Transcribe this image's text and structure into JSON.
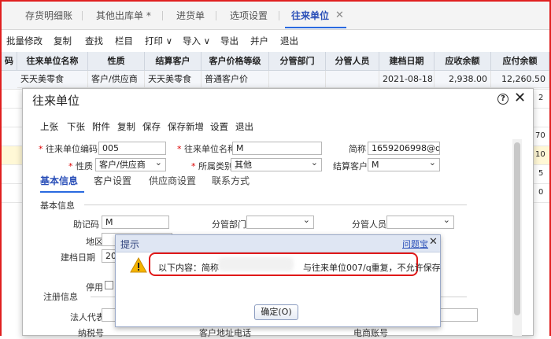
{
  "tabs": [
    {
      "label": "存货明细账"
    },
    {
      "label": "其他出库单 *"
    },
    {
      "label": "进货单"
    },
    {
      "label": "选项设置"
    },
    {
      "label": "往来单位"
    }
  ],
  "toolbar": [
    "批量修改",
    "复制",
    "查找",
    "栏目",
    "打印 ∨",
    "导入 ∨",
    "导出",
    "并户",
    "退出"
  ],
  "grid": {
    "headers": [
      "码",
      "往来单位名称",
      "性质",
      "结算客户",
      "客户价格等级",
      "分管部门",
      "分管人员",
      "建档日期",
      "应收余额",
      "应付余额"
    ],
    "row1": [
      "天天美零食",
      "客户/供应商",
      "天天美零食",
      "普通客户价",
      "",
      "",
      "2021-08-18",
      "2,938.00",
      "12,260.50"
    ],
    "edge_values": [
      "2",
      "70",
      "10",
      "5",
      "0"
    ]
  },
  "dialog": {
    "title": "往来单位",
    "help": "?",
    "close": "✕",
    "toolbar": [
      "上张",
      "下张",
      "附件",
      "复制",
      "保存",
      "保存新增",
      "设置",
      "退出"
    ],
    "fields": {
      "code_label": "往来单位编码",
      "code_value": "005",
      "name_label": "往来单位名称",
      "name_value": "M",
      "abbr_label": "简称",
      "abbr_value": "1659206998@q...",
      "nature_label": "性质",
      "nature_value": "客户/供应商",
      "category_label": "所属类别",
      "category_value": "其他",
      "settle_label": "结算客户",
      "settle_value": "M"
    },
    "subtabs": [
      "基本信息",
      "客户设置",
      "供应商设置",
      "联系方式"
    ],
    "section_basic": "基本信息",
    "mnemonic_label": "助记码",
    "mnemonic_value": "M",
    "dept_label": "分管部门",
    "staff_label": "分管人员",
    "region_label": "地区",
    "created_label": "建档日期",
    "created_value": "202",
    "disabled_label": "停用",
    "section_reg": "注册信息",
    "legal_label": "法人代表",
    "tax_label": "纳税号",
    "addr_label": "客户地址电话",
    "phone_label": "电商账号"
  },
  "alert": {
    "title": "提示",
    "help_link": "问题宝",
    "close": "✕",
    "message_prefix": "以下内容：简称",
    "message_suffix": "与往来单位007/q重复，不允许保存",
    "ok_label": "确定(O)"
  }
}
